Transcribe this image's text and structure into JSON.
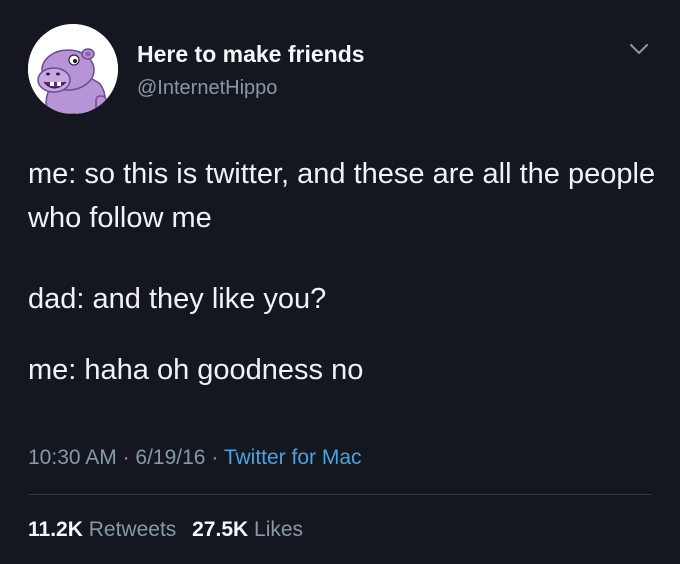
{
  "tweet": {
    "author": {
      "display_name": "Here to make friends",
      "handle": "@InternetHippo",
      "avatar_icon": "purple-hippo-avatar"
    },
    "menu_icon": "chevron-down-icon",
    "lines": [
      "me: so this is twitter, and these are all the people who follow me",
      "dad: and they like you?",
      "me: haha oh goodness no"
    ],
    "time": "10:30 AM",
    "separator": "·",
    "date": "6/19/16",
    "source": "Twitter for Mac",
    "retweets_count": "11.2K",
    "retweets_label": "Retweets",
    "likes_count": "27.5K",
    "likes_label": "Likes"
  },
  "colors": {
    "background": "#14171f",
    "text": "#f0f3f5",
    "muted": "#8899a6",
    "link": "#4aa3df",
    "avatar_purple": "#b794d6"
  }
}
